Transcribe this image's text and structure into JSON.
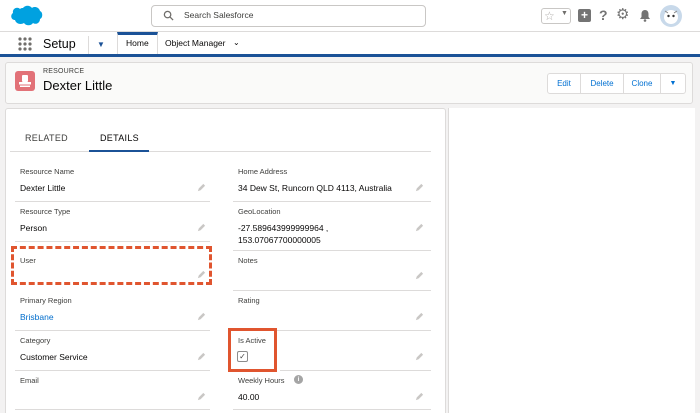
{
  "header": {
    "search_placeholder": "Search Salesforce"
  },
  "nav": {
    "app_name": "Setup",
    "tabs": [
      {
        "label": "Home"
      },
      {
        "label": "Object Manager"
      }
    ]
  },
  "record": {
    "object_type": "RESOURCE",
    "name": "Dexter Little",
    "actions": [
      "Edit",
      "Delete",
      "Clone"
    ]
  },
  "detail_tabs": [
    "RELATED",
    "DETAILS"
  ],
  "fields": {
    "resource_name": {
      "label": "Resource Name",
      "value": "Dexter Little"
    },
    "home_address": {
      "label": "Home Address",
      "value": "34 Dew St, Runcorn QLD 4113, Australia"
    },
    "resource_type": {
      "label": "Resource Type",
      "value": "Person"
    },
    "geolocation": {
      "label": "GeoLocation",
      "value_line1": "-27.589643999999964 ,",
      "value_line2": "153.07067700000005"
    },
    "user": {
      "label": "User",
      "value": ""
    },
    "notes": {
      "label": "Notes",
      "value": ""
    },
    "primary_region": {
      "label": "Primary Region",
      "value": "Brisbane"
    },
    "rating": {
      "label": "Rating",
      "value": ""
    },
    "category": {
      "label": "Category",
      "value": "Customer Service"
    },
    "is_active": {
      "label": "Is Active",
      "checked": true
    },
    "email": {
      "label": "Email",
      "value": ""
    },
    "weekly_hours": {
      "label": "Weekly Hours",
      "value": "40.00"
    }
  },
  "colors": {
    "brand": "#1b5297",
    "link": "#006dcc",
    "highlight": "#e0552f",
    "resource_icon": "#e27278"
  }
}
